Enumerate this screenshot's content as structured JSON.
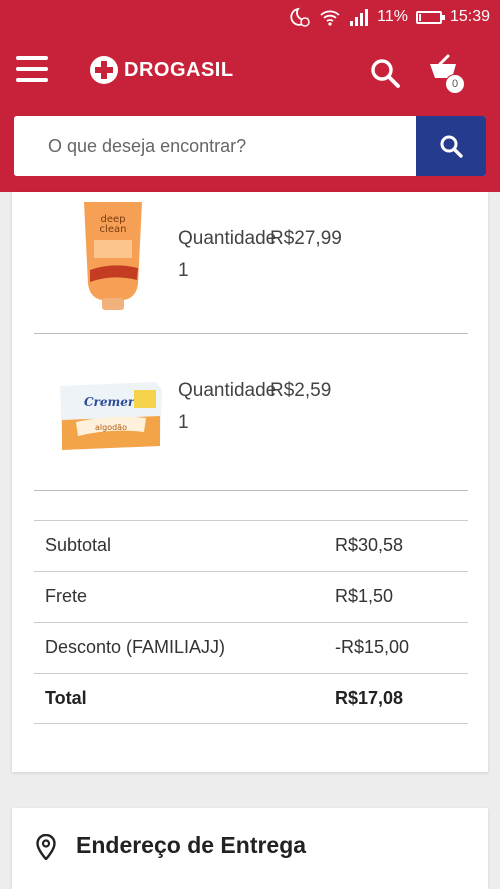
{
  "status_bar": {
    "signal": "11%",
    "time": "15:39",
    "battery_level": 0.11,
    "icons": [
      "moon-alarm-icon",
      "wifi-icon",
      "signal-icon",
      "battery-icon"
    ]
  },
  "header": {
    "brand": "DROGASIL",
    "cart_count": "0",
    "icons": [
      "menu-icon",
      "search-icon",
      "cart-icon"
    ]
  },
  "search": {
    "placeholder": "O que deseja encontrar?"
  },
  "products": [
    {
      "qty_label": "Quantidade",
      "qty": "1",
      "price": "R$27,99",
      "image": "neutrogena-deep-clean-tube"
    },
    {
      "qty_label": "Quantidade",
      "qty": "1",
      "price": "R$2,59",
      "image": "cremer-algodao-box"
    }
  ],
  "summary": {
    "subtotal_label": "Subtotal",
    "subtotal": "R$30,58",
    "shipping_label": "Frete",
    "shipping": "R$1,50",
    "discount_label": "Desconto (FAMILIAJJ)",
    "discount": "-R$15,00",
    "total_label": "Total",
    "total": "R$17,08"
  },
  "delivery": {
    "title": "Endereço de Entrega",
    "icon": "location-pin-icon"
  },
  "colors": {
    "brand_red": "#c8223a",
    "search_blue": "#243b8e"
  }
}
